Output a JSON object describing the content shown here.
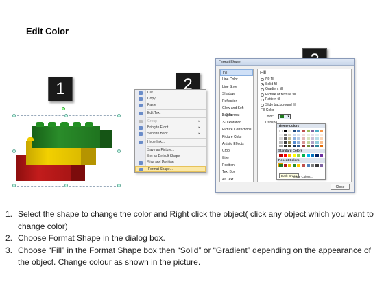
{
  "title": "Edit Color",
  "markers": [
    "1",
    "2",
    "3"
  ],
  "context_menu": {
    "items": [
      {
        "label": "Cut",
        "dim": false,
        "arrow": false
      },
      {
        "label": "Copy",
        "dim": false,
        "arrow": false
      },
      {
        "label": "Paste",
        "dim": false,
        "arrow": false
      },
      {
        "label": "Edit Text",
        "dim": false,
        "arrow": false
      },
      {
        "label": "Group",
        "dim": true,
        "arrow": true
      },
      {
        "label": "Bring to Front",
        "dim": false,
        "arrow": true
      },
      {
        "label": "Send to Back",
        "dim": false,
        "arrow": true
      },
      {
        "label": "Hyperlink...",
        "dim": false,
        "arrow": false
      },
      {
        "label": "Save as Picture...",
        "dim": false,
        "arrow": false
      },
      {
        "label": "Set as Default Shape",
        "dim": false,
        "arrow": false
      },
      {
        "label": "Size and Position...",
        "dim": false,
        "arrow": false
      },
      {
        "label": "Format Shape...",
        "dim": false,
        "arrow": false,
        "highlight": true
      }
    ]
  },
  "dialog": {
    "title": "Format Shape",
    "nav": [
      "Fill",
      "Line Color",
      "Line Style",
      "Shadow",
      "Reflection",
      "Glow and Soft Edges",
      "3-D Format",
      "3-D Rotation",
      "Picture Corrections",
      "Picture Color",
      "Artistic Effects",
      "Crop",
      "Size",
      "Position",
      "Text Box",
      "Alt Text"
    ],
    "pane_heading": "Fill",
    "options": [
      {
        "label": "No fill",
        "on": false
      },
      {
        "label": "Solid fill",
        "on": true
      },
      {
        "label": "Gradient fill",
        "on": false
      },
      {
        "label": "Picture or texture fill",
        "on": false
      },
      {
        "label": "Pattern fill",
        "on": false
      },
      {
        "label": "Slide background fill",
        "on": false
      }
    ],
    "fill_color_label": "Fill Color",
    "color_label": "Color:",
    "transparency_label": "Transpa",
    "close_label": "Close"
  },
  "color_picker": {
    "theme_label": "Theme Colors",
    "standard_label": "Standard Colors",
    "recent_label": "Recent Colors",
    "tooltip": "Dark Green",
    "more_label": "More Colors..."
  },
  "colors": {
    "green": "#1f7a1f",
    "yellow": "#e8c400",
    "red": "#b31616"
  },
  "instructions": [
    {
      "num": "1.",
      "text": "Select the shape to change the color and Right click the object( click any object which you want to change color)"
    },
    {
      "num": "2.",
      "text": "Choose Format Shape in the dialog box."
    },
    {
      "num": "3.",
      "text": "Choose “Fill” in the Format Shape box then “Solid” or “Gradient” depending on the appearance of the object. Change colour as shown in the picture."
    }
  ]
}
